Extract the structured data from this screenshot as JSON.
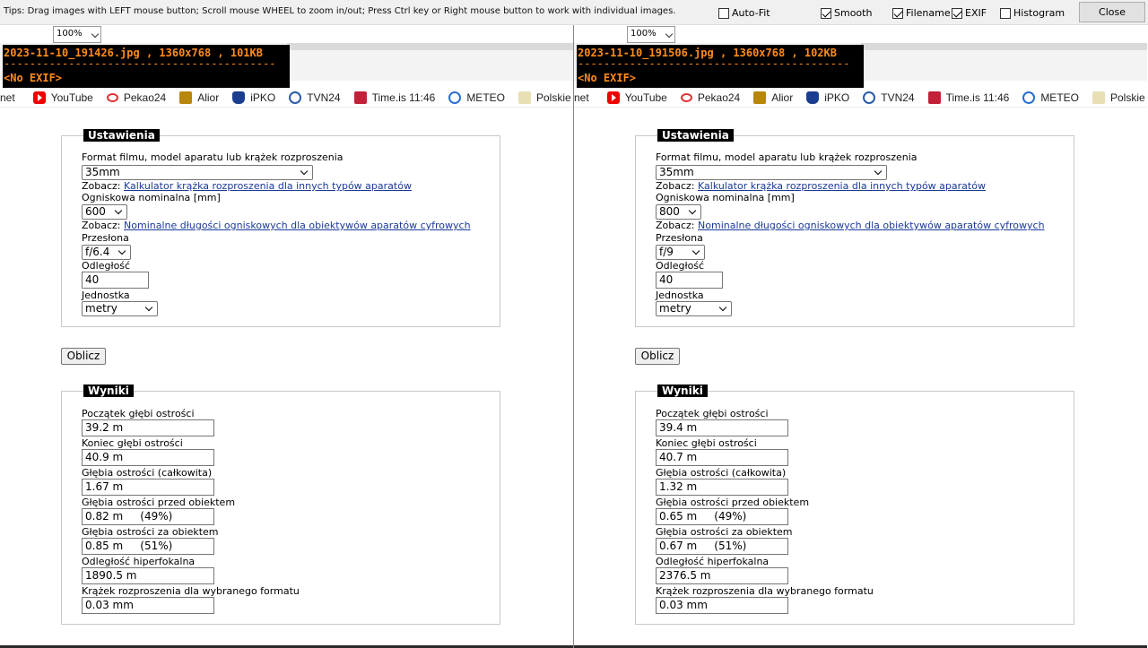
{
  "toolbar": {
    "tips": "Tips: Drag images with LEFT mouse button; Scroll mouse WHEEL to zoom in/out; Press Ctrl key or Right mouse button to work with individual images.",
    "options": [
      {
        "label": "Auto-Fit",
        "checked": false
      },
      {
        "label": "Smooth",
        "checked": true
      },
      {
        "label": "Filename",
        "checked": true
      },
      {
        "label": "EXIF",
        "checked": true
      },
      {
        "label": "Histogram",
        "checked": false
      }
    ],
    "close_label": "Close"
  },
  "bookmarks": [
    {
      "label": "net",
      "icon": "none"
    },
    {
      "label": "YouTube",
      "icon": "youtube-icon"
    },
    {
      "label": "Pekao24",
      "icon": "pekao-icon"
    },
    {
      "label": "Alior",
      "icon": "alior-icon"
    },
    {
      "label": "iPKO",
      "icon": "ipko-icon"
    },
    {
      "label": "TVN24",
      "icon": "tvn24-icon"
    },
    {
      "label": "Time.is 11:46",
      "icon": "timeis-icon"
    },
    {
      "label": "METEO",
      "icon": "meteo-icon"
    },
    {
      "label": "Polskie me",
      "icon": "polskie-icon"
    }
  ],
  "labels": {
    "settings_legend": "Ustawienia",
    "format_label": "Format filmu, model aparatu lub krążek rozproszenia",
    "see": "Zobacz:",
    "coc_link": "Kalkulator krążka rozproszenia dla innych typów aparatów",
    "focal_label": "Ogniskowa nominalna [mm]",
    "nominal_link": "Nominalne długości ogniskowych dla obiektywów aparatów cyfrowych",
    "aperture_label": "Przesłona",
    "distance_label": "Odległość",
    "unit_label": "Jednostka",
    "calc_button": "Oblicz",
    "results_legend": "Wyniki",
    "near_label": "Początek głębi ostrości",
    "far_label": "Koniec głębi ostrości",
    "total_label": "Głębia ostrości (całkowita)",
    "front_label": "Głębia ostrości przed obiektem",
    "behind_label": "Głębia ostrości za obiektem",
    "hyper_label": "Odległość hiperfokalna",
    "coc_label": "Krążek rozproszenia dla wybranego formatu"
  },
  "panes": [
    {
      "zoom": "100%",
      "info_line1": "2023-11-10_191426.jpg , 1360x768 , 101KB",
      "info_dashes": "------------------------------------------",
      "info_exif": "<No EXIF>",
      "format": "35mm",
      "focal": "600",
      "aperture": "f/6.4",
      "distance": "40",
      "unit": "metry",
      "results": {
        "near": "39.2 m",
        "far": "40.9 m",
        "total": "1.67 m",
        "front": "0.82 m     (49%)",
        "behind": "0.85 m     (51%)",
        "hyper": "1890.5 m",
        "coc": "0.03 mm"
      }
    },
    {
      "zoom": "100%",
      "info_line1": "2023-11-10_191506.jpg , 1360x768 , 102KB",
      "info_dashes": "------------------------------------------",
      "info_exif": "<No EXIF>",
      "format": "35mm",
      "focal": "800",
      "aperture": "f/9",
      "distance": "40",
      "unit": "metry",
      "results": {
        "near": "39.4 m",
        "far": "40.7 m",
        "total": "1.32 m",
        "front": "0.65 m     (49%)",
        "behind": "0.67 m     (51%)",
        "hyper": "2376.5 m",
        "coc": "0.03 mm"
      }
    }
  ]
}
